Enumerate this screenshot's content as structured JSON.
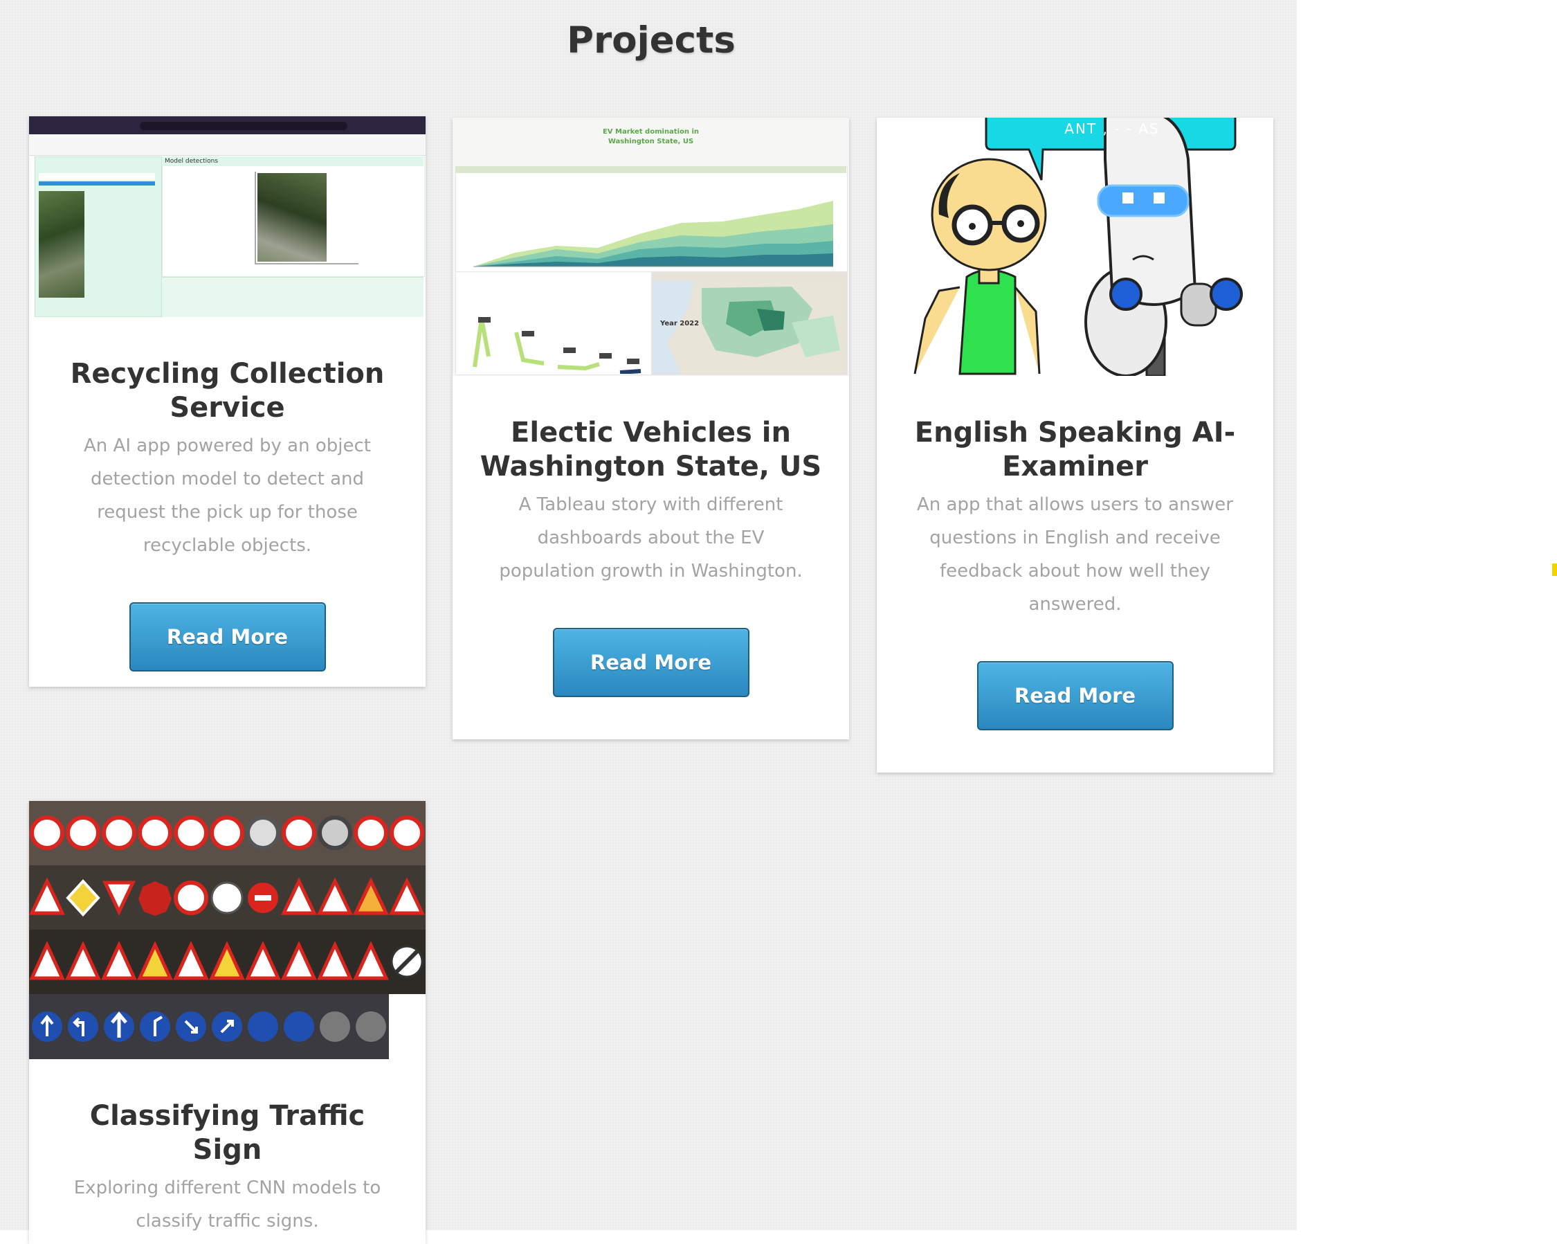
{
  "section": {
    "title": "Projects"
  },
  "cards": [
    {
      "title": "Recycling Collection Service",
      "description": "An AI app powered by an object detection model to detect and request the pick up for those recyclable objects.",
      "button": "Read More",
      "image_caption": "Model detections"
    },
    {
      "title": "Electic Vehicles in Washington State, US",
      "description": "A Tableau story with different dashboards about the EV population growth in Washington.",
      "button": "Read More",
      "image_title": "EV Market domination in Washington State, US",
      "image_year": "Year 2022"
    },
    {
      "title": "English Speaking AI-Examiner",
      "description": "An app that allows users to answer questions in English and receive feedback about how well they answered.",
      "button": "Read More",
      "bubble_text": "ANT , - - AS"
    },
    {
      "title": "Classifying Traffic Sign",
      "description": "Exploring different CNN models to classify traffic signs."
    }
  ],
  "colors": {
    "button_top": "#4eb4e3",
    "button_bottom": "#2a88bf",
    "title": "#333333",
    "description": "#a3a3a3"
  }
}
